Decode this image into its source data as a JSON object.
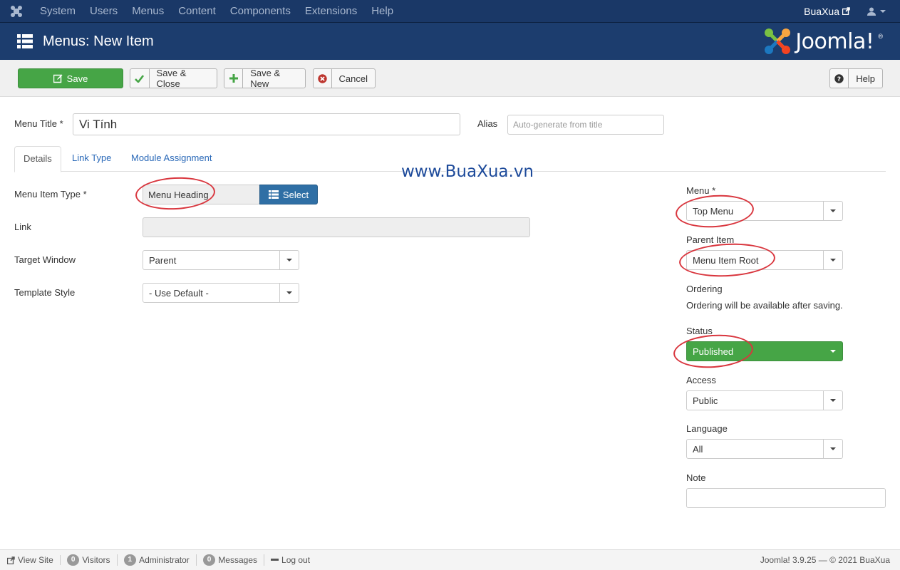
{
  "topnav": {
    "items": [
      "System",
      "Users",
      "Menus",
      "Content",
      "Components",
      "Extensions",
      "Help"
    ],
    "site_name": "BuaXua"
  },
  "header": {
    "title": "Menus: New Item",
    "brand": "Joomla!"
  },
  "toolbar": {
    "save": "Save",
    "save_close": "Save & Close",
    "save_new": "Save & New",
    "cancel": "Cancel",
    "help": "Help"
  },
  "form": {
    "menu_title_label": "Menu Title *",
    "menu_title_value": "Vi Tính",
    "alias_label": "Alias",
    "alias_placeholder": "Auto-generate from title"
  },
  "tabs": [
    "Details",
    "Link Type",
    "Module Assignment"
  ],
  "watermark": "www.BuaXua.vn",
  "details": {
    "menu_item_type_label": "Menu Item Type *",
    "menu_item_type_value": "Menu Heading",
    "select_button": "Select",
    "link_label": "Link",
    "link_value": "",
    "target_window_label": "Target Window",
    "target_window_value": "Parent",
    "template_style_label": "Template Style",
    "template_style_value": "- Use Default -"
  },
  "sidebar": {
    "menu_label": "Menu *",
    "menu_value": "Top Menu",
    "parent_label": "Parent Item",
    "parent_value": "Menu Item Root",
    "ordering_label": "Ordering",
    "ordering_text": "Ordering will be available after saving.",
    "status_label": "Status",
    "status_value": "Published",
    "status_color": "#46a546",
    "access_label": "Access",
    "access_value": "Public",
    "language_label": "Language",
    "language_value": "All",
    "note_label": "Note",
    "note_value": ""
  },
  "statusbar": {
    "view_site": "View Site",
    "visitors_count": "0",
    "visitors_label": "Visitors",
    "admin_count": "1",
    "admin_label": "Administrator",
    "messages_count": "0",
    "messages_label": "Messages",
    "logout": "Log out",
    "copyright": "Joomla! 3.9.25 — © 2021 BuaXua"
  },
  "icons": {
    "joomla_logo": "joomla-logo-icon",
    "menu_list": "list-icon",
    "external_link": "external-link-icon",
    "user": "user-icon",
    "edit": "edit-icon",
    "check": "check-icon",
    "plus": "plus-icon",
    "cancel": "cancel-icon",
    "help": "question-icon"
  }
}
